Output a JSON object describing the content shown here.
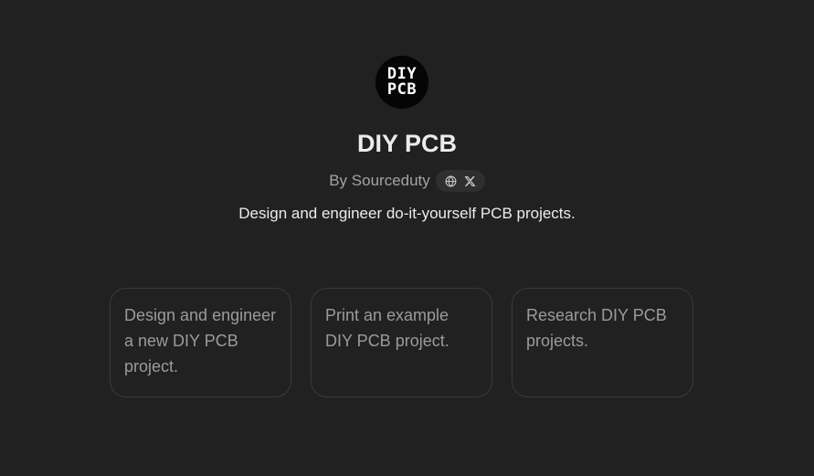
{
  "app": {
    "logo_lines": [
      "DIY",
      "PCB"
    ],
    "title": "DIY PCB",
    "author": "By Sourceduty",
    "description": "Design and engineer do-it-yourself PCB projects."
  },
  "social": [
    {
      "icon": "globe-icon"
    },
    {
      "icon": "x-logo-icon"
    }
  ],
  "starters": [
    {
      "text": "Design and engineer a new DIY PCB project."
    },
    {
      "text": "Print an example DIY PCB project."
    },
    {
      "text": "Research DIY PCB projects."
    }
  ],
  "colors": {
    "background": "#212121",
    "card_border": "#3a3a3a",
    "muted_text": "#a3a3a3",
    "pill_bg": "#2f2f2f"
  }
}
